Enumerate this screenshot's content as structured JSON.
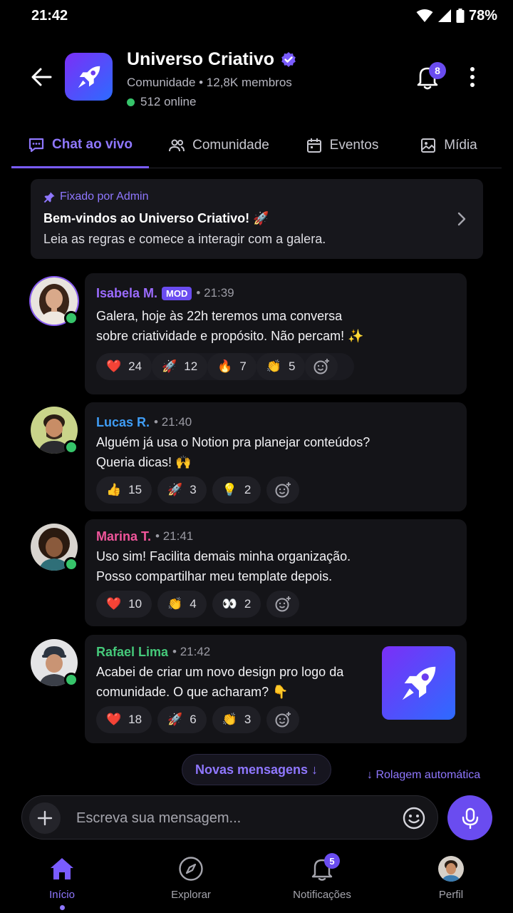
{
  "status_bar": {
    "time": "21:42",
    "battery": "78%"
  },
  "header": {
    "title": "Universo Criativo",
    "subtitle": "Comunidade • 12,8K membros",
    "online": "512 online",
    "notif_count": "8"
  },
  "tabs": [
    {
      "label": "Chat ao vivo",
      "icon": "chat-icon"
    },
    {
      "label": "Comunidade",
      "icon": "people-icon"
    },
    {
      "label": "Eventos",
      "icon": "calendar-icon"
    },
    {
      "label": "Mídia",
      "icon": "image-icon"
    }
  ],
  "pinned": {
    "label": "Fixado por Admin",
    "title": "Bem-vindos ao Universo Criativo! 🚀",
    "body": "Leia as regras e comece a interagir com a galera."
  },
  "messages": [
    {
      "name": "Isabela M.",
      "badge": "MOD",
      "time": "• 21:39",
      "color": "#9b6bff",
      "line1": "Galera, hoje às 22h teremos uma conversa",
      "line2": "sobre criatividade e propósito. Não percam! ✨",
      "reactions": [
        {
          "emoji": "❤️",
          "count": "24"
        },
        {
          "emoji": "🚀",
          "count": "12"
        },
        {
          "emoji": "🔥",
          "count": "7"
        },
        {
          "emoji": "👏",
          "count": "5"
        }
      ]
    },
    {
      "name": "Lucas R.",
      "time": "• 21:40",
      "color": "#3f9df5",
      "line1": "Alguém já usa o Notion pra planejar conteúdos?",
      "line2": "Queria dicas! 🙌",
      "reactions": [
        {
          "emoji": "👍",
          "count": "15"
        },
        {
          "emoji": "🚀",
          "count": "3"
        },
        {
          "emoji": "💡",
          "count": "2"
        }
      ]
    },
    {
      "name": "Marina T.",
      "time": "• 21:41",
      "color": "#f0559b",
      "line1": "Uso sim! Facilita demais minha organização.",
      "line2": "Posso compartilhar meu template depois.",
      "reactions": [
        {
          "emoji": "❤️",
          "count": "10"
        },
        {
          "emoji": "👏",
          "count": "4"
        },
        {
          "emoji": "👀",
          "count": "2"
        }
      ]
    },
    {
      "name": "Rafael Lima",
      "time": "• 21:42",
      "color": "#45c97a",
      "line1": "Acabei de criar um novo design pro logo da",
      "line2": "comunidade. O que acharam? 👇",
      "reactions": [
        {
          "emoji": "❤️",
          "count": "18"
        },
        {
          "emoji": "🚀",
          "count": "6"
        },
        {
          "emoji": "👏",
          "count": "3"
        }
      ]
    }
  ],
  "new_messages": "Novas mensagens ↓",
  "auto_scroll": "↓ Rolagem automática",
  "composer": {
    "placeholder": "Escreva sua mensagem..."
  },
  "bottom_nav": {
    "home": "Início",
    "explore": "Explorar",
    "notifications": "Notificações",
    "notifications_count": "5",
    "profile": "Perfil"
  },
  "colors": {
    "accent": "#6a4cf0",
    "accent_text": "#8f77ff",
    "online": "#36c46a"
  }
}
